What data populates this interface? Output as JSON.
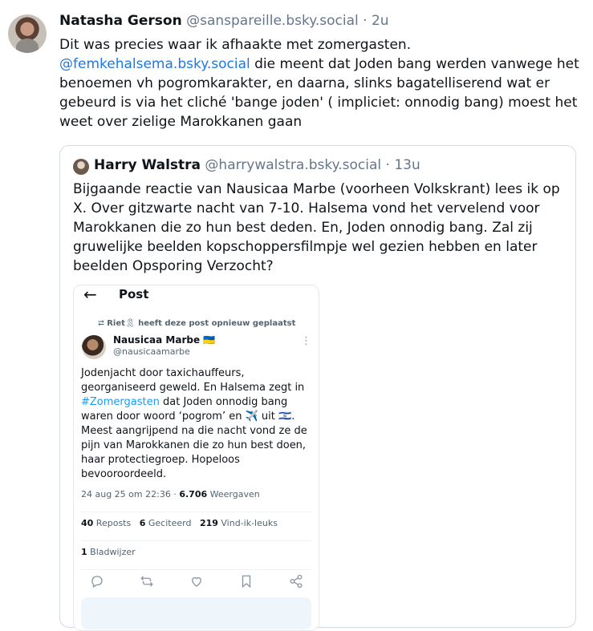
{
  "post": {
    "author_name": "Natasha Gerson",
    "author_handle": "@sanspareille.bsky.social",
    "separator": " · ",
    "time": "2u",
    "text_1": "Dit was precies waar ik afhaakte met zomergasten.",
    "mention": "@femkehalsema.bsky.social",
    "text_2": " die meent dat Joden bang werden vanwege het benoemen vh pogromkarakter, en daarna, slinks bagatelliserend wat er gebeurd is via het cliché  'bange joden' ( impliciet: onnodig bang) moest het weet over zielige Marokkanen gaan"
  },
  "quote": {
    "author_name": "Harry Walstra",
    "author_handle": "@harrywalstra.bsky.social",
    "separator": " · ",
    "time": "13u",
    "text": "Bijgaande reactie van Nausicaa Marbe (voorheen Volkskrant) lees ik op X. Over gitzwarte nacht van 7-10. Halsema vond het vervelend voor Marokkanen die zo hun best deden. En, Joden onnodig bang. Zal zij gruwelijke beelden kopschoppersfilmpje wel gezien hebben en later beelden Opsporing Verzocht?"
  },
  "screenshot": {
    "back_icon": "←",
    "title": "Post",
    "repost_icon": "⮂",
    "repost_name": "Riet",
    "repost_ribbon": "🎗",
    "repost_text": " heeft deze post opnieuw geplaatst",
    "author_name": "Nausicaa Marbe",
    "author_flag": "🇺🇦",
    "author_handle": "@nausicaamarbe",
    "more_icon": "⋮",
    "text_1": "Jodenjacht door taxichauffeurs, georganiseerd geweld. En Halsema zegt in ",
    "hashtag": "#Zomergasten",
    "text_2": " dat Joden onnodig bang waren door woord ‘pogrom’ en ✈️ uit 🇮🇱. Meest aangrijpend na die nacht vond ze de pijn van Marokkanen die zo hun best doen, haar protectiegroep. Hopeloos bevooroordeeld.",
    "date": "24 aug 25 om 22:36",
    "views_sep": " · ",
    "views_count": "6.706",
    "views_label": " Weergaven",
    "reposts_count": "40",
    "reposts_label": " Reposts",
    "quotes_count": "6",
    "quotes_label": " Geciteerd",
    "likes_count": "219",
    "likes_label": " Vind-ik-leuks",
    "bookmarks_count": "1",
    "bookmarks_label": " Bladwijzer",
    "accent_color": "#1d9bf0"
  }
}
